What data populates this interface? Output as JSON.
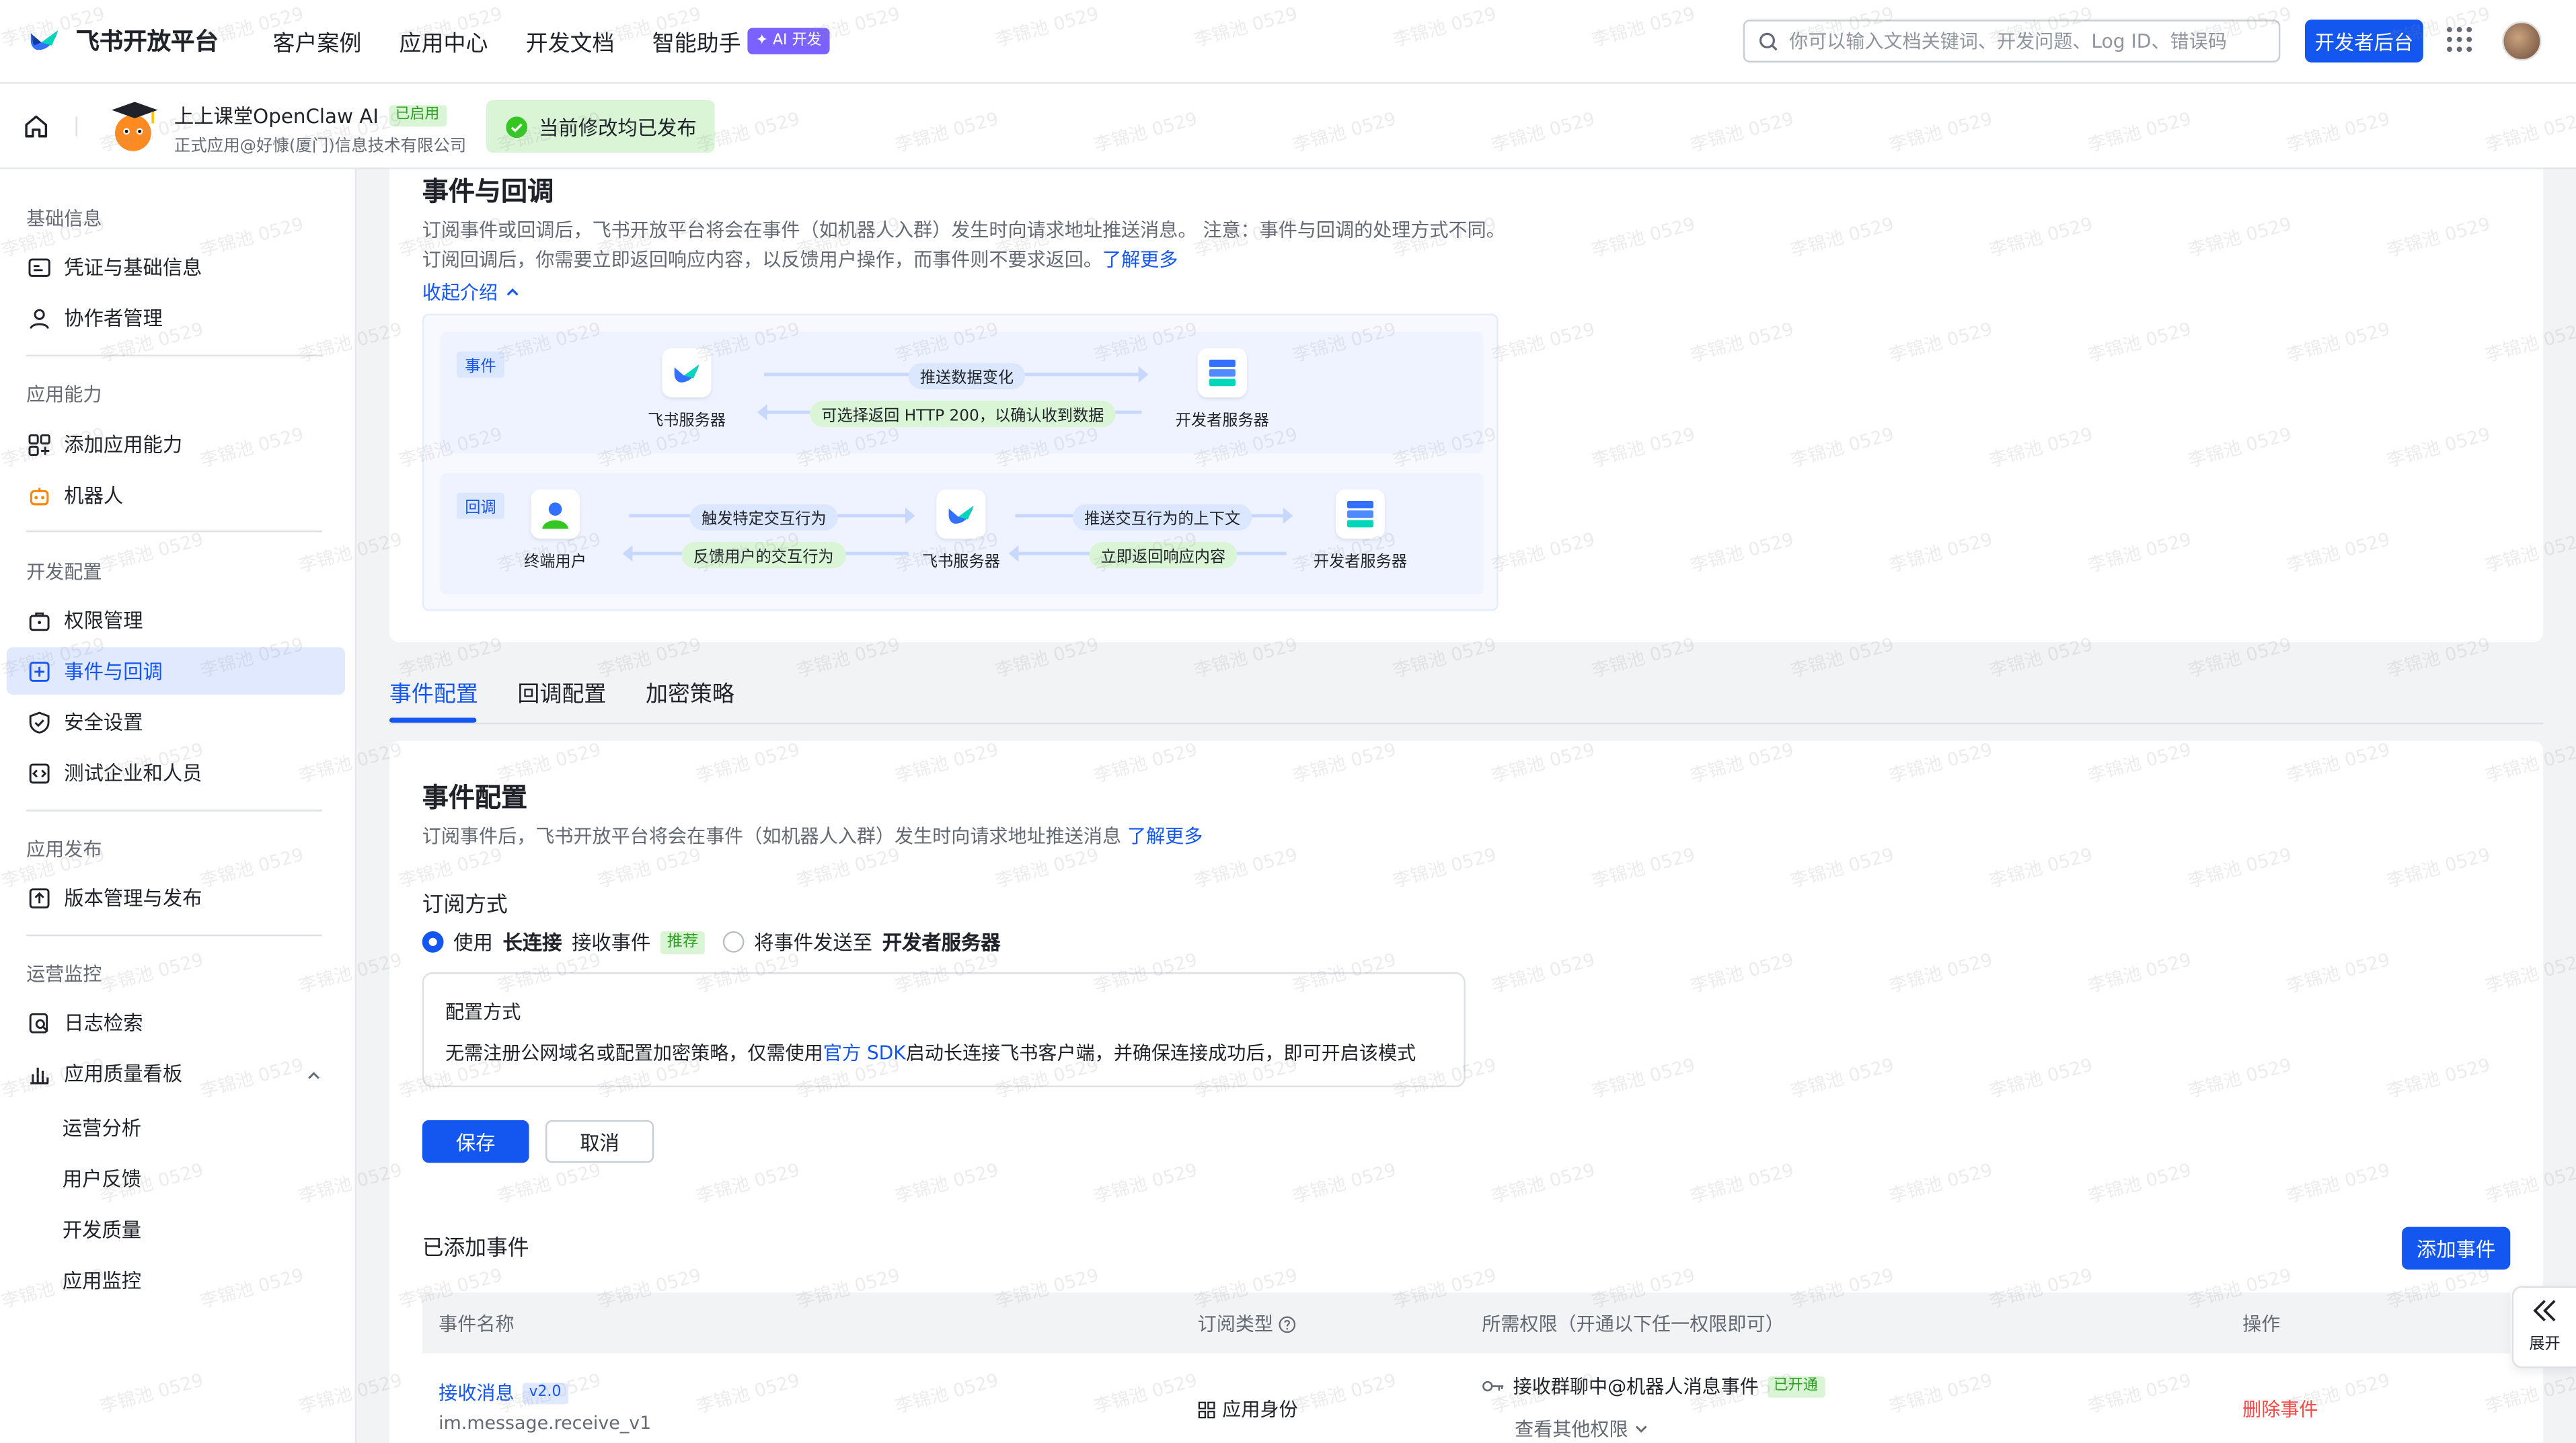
{
  "header": {
    "brand": "飞书开放平台",
    "nav": [
      "客户案例",
      "应用中心",
      "开发文档",
      "智能助手"
    ],
    "ai_badge": "✦ AI 开发",
    "search_placeholder": "你可以输入文档关键词、开发问题、Log ID、错误码",
    "dev_console": "开发者后台"
  },
  "appbar": {
    "app_name": "上上课堂OpenClaw AI",
    "status": "已启用",
    "subtitle": "正式应用@好慷(厦门)信息技术有限公司",
    "publish_status": "当前修改均已发布"
  },
  "sidebar": {
    "groups": {
      "basic": "基础信息",
      "ability": "应用能力",
      "dev": "开发配置",
      "release": "应用发布",
      "ops": "运营监控"
    },
    "items": {
      "credentials": "凭证与基础信息",
      "collaborators": "协作者管理",
      "add_ability": "添加应用能力",
      "bot": "机器人",
      "permissions": "权限管理",
      "events": "事件与回调",
      "security": "安全设置",
      "test_org": "测试企业和人员",
      "versions": "版本管理与发布",
      "logs": "日志检索",
      "quality": "应用质量看板"
    },
    "sub_items": [
      "运营分析",
      "用户反馈",
      "开发质量",
      "应用监控"
    ]
  },
  "intro": {
    "title": "事件与回调",
    "desc1": "订阅事件或回调后，飞书开放平台将会在事件（如机器人入群）发生时向请求地址推送消息。 注意：事件与回调的处理方式不",
    "desc2": "同。订阅回调后，你需要立即返回响应内容，以反馈用户操作，而事件则不要求返回。",
    "learn_more": "了解更多",
    "collapse": "收起介绍",
    "diagram": {
      "event_tag": "事件",
      "callback_tag": "回调",
      "feishu_server": "飞书服务器",
      "dev_server": "开发者服务器",
      "end_user": "终端用户",
      "push_data": "推送数据变化",
      "optional_return": "可选择返回 HTTP 200，以确认收到数据",
      "trigger": "触发特定交互行为",
      "feedback": "反馈用户的交互行为",
      "push_context": "推送交互行为的上下文",
      "immediate_return": "立即返回响应内容"
    }
  },
  "tabs": [
    "事件配置",
    "回调配置",
    "加密策略"
  ],
  "event_config": {
    "title": "事件配置",
    "desc": "订阅事件后，飞书开放平台将会在事件（如机器人入群）发生时向请求地址推送消息",
    "learn_more": "了解更多",
    "sub_mode_title": "订阅方式",
    "opt1_pre": "使用",
    "opt1_bold": "长连接",
    "opt1_post": "接收事件",
    "recommended": "推荐",
    "opt2_pre": "将事件发送至",
    "opt2_bold": "开发者服务器",
    "cfg_title": "配置方式",
    "cfg_pre": "无需注册公网域名或配置加密策略，仅需使用",
    "cfg_link": "官方 SDK",
    "cfg_post": "启动长连接飞书客户端，并确保连接成功后，即可开启该模式",
    "save": "保存",
    "cancel": "取消"
  },
  "added_events": {
    "title": "已添加事件",
    "add_button": "添加事件",
    "columns": [
      "事件名称",
      "订阅类型",
      "所需权限（开通以下任一权限即可）",
      "操作"
    ],
    "rows": [
      {
        "name": "接收消息",
        "version": "v2.0",
        "key": "im.message.receive_v1",
        "type": "应用身份",
        "permission": "接收群聊中@机器人消息事件",
        "perm_status": "已开通",
        "more_perms": "查看其他权限",
        "action": "删除事件"
      }
    ]
  },
  "expand_panel": "展开",
  "watermark": "李锦池 0529"
}
